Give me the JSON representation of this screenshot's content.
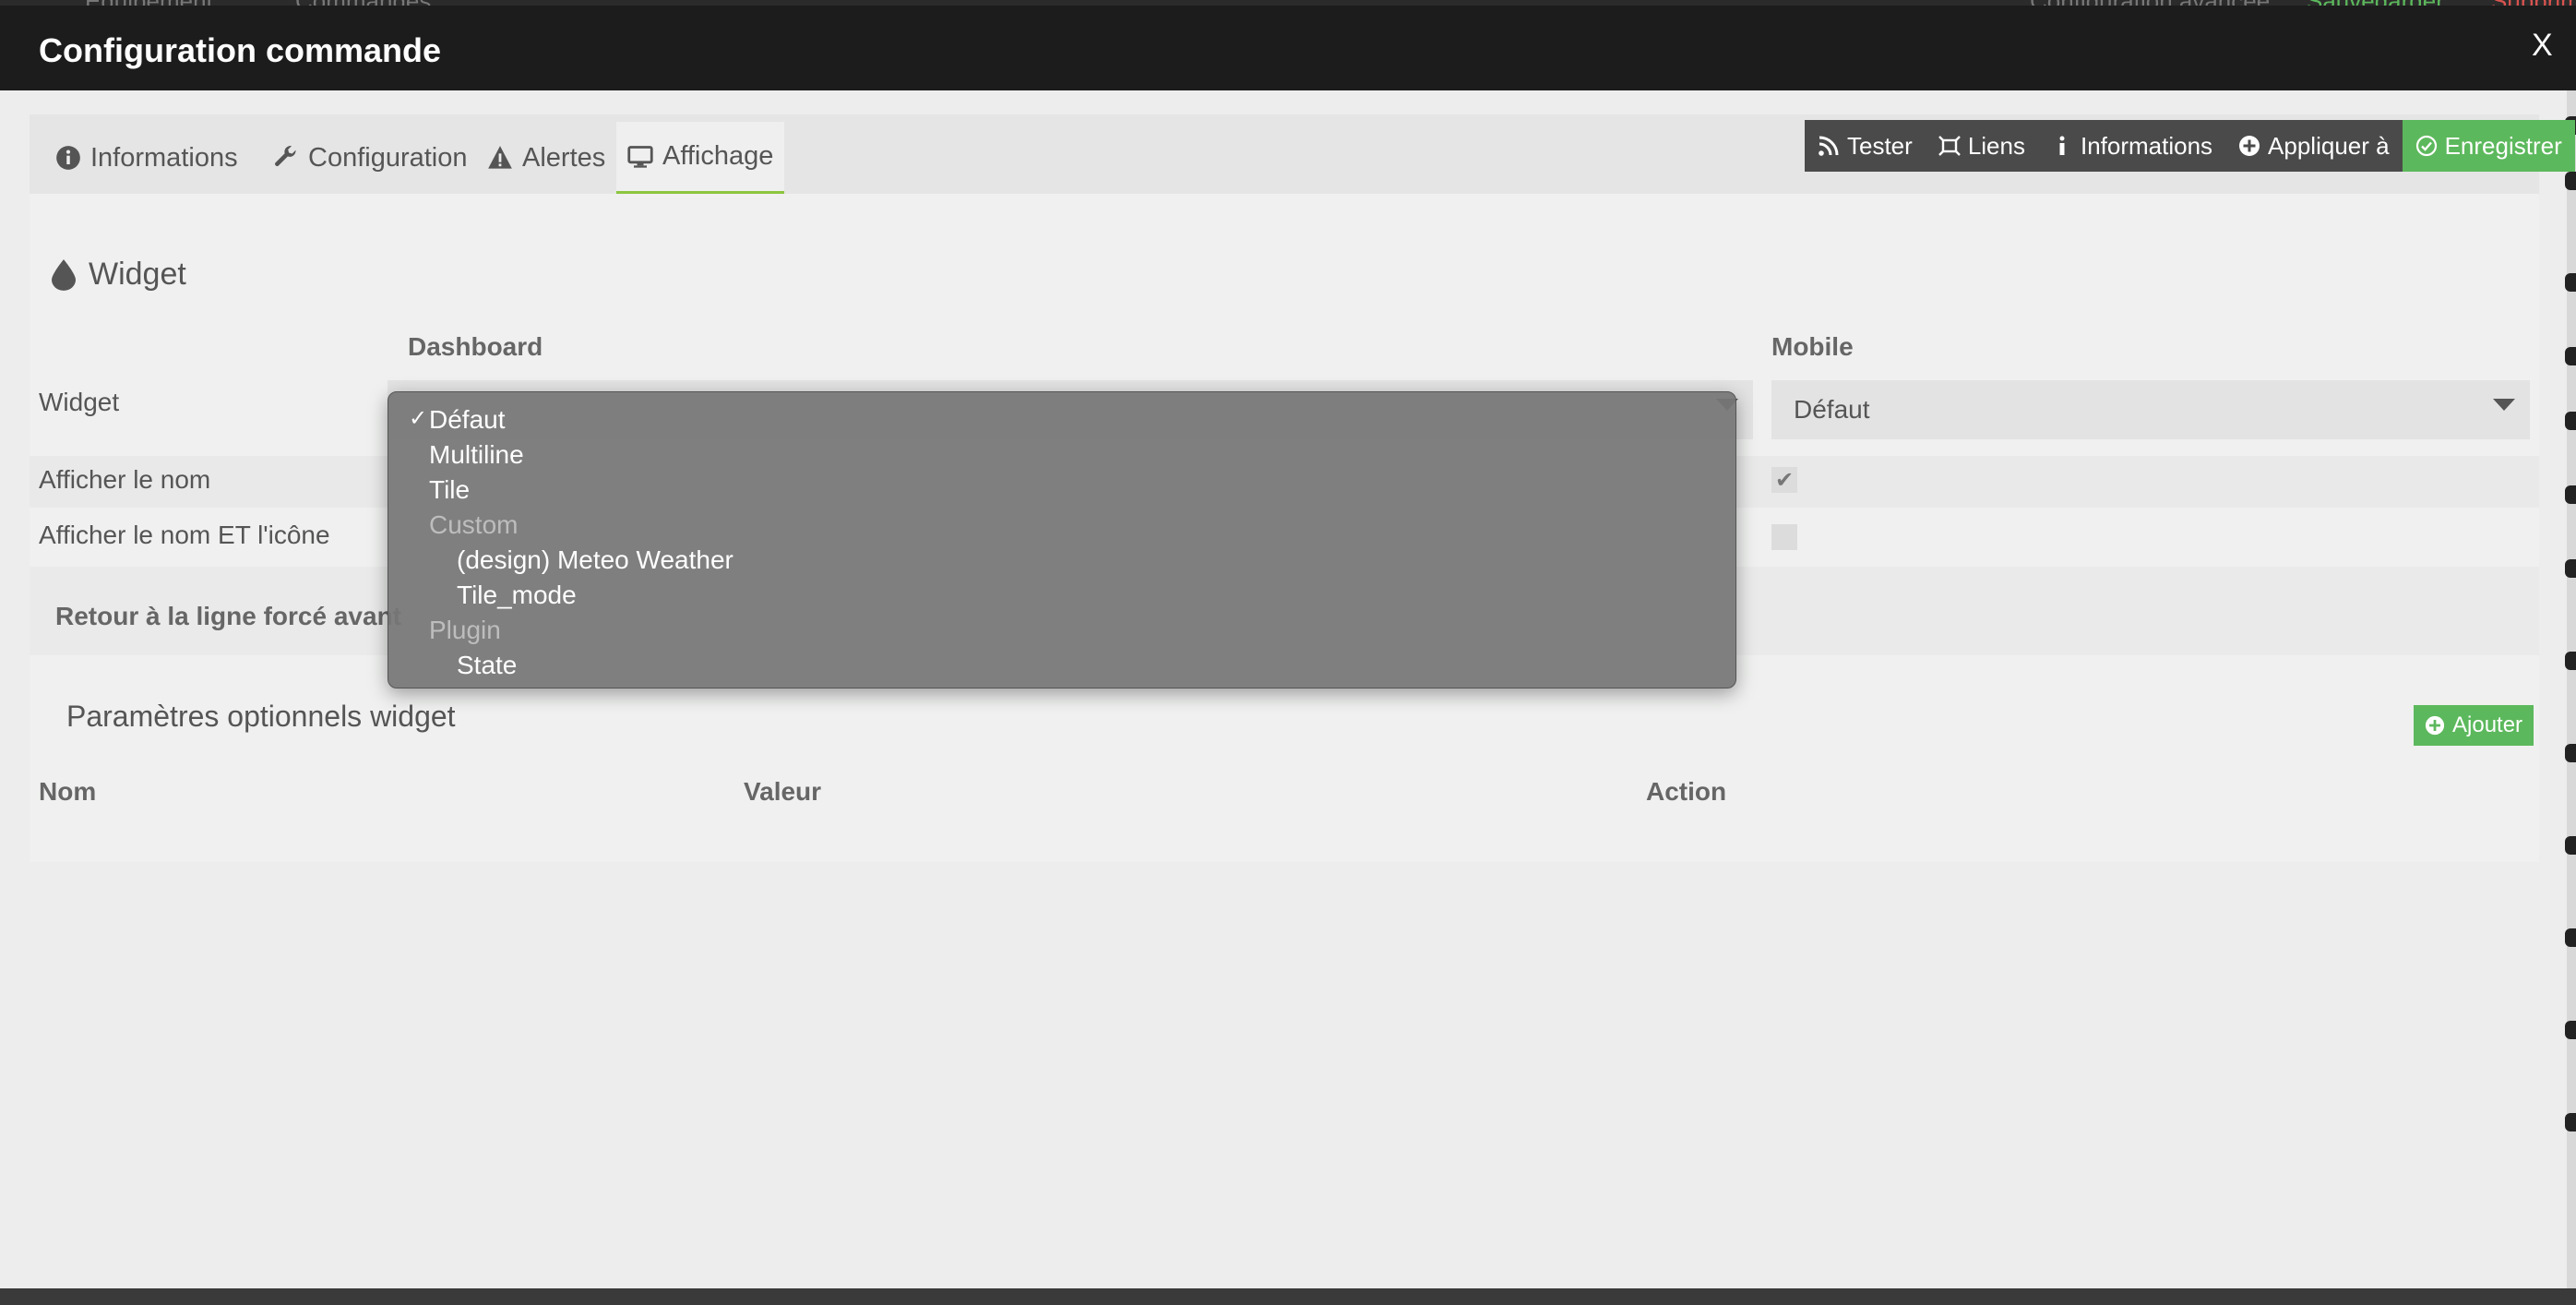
{
  "background": {
    "left_items": [
      "Équipement",
      "Commandes"
    ],
    "right_items": [
      "Configuration avancée",
      "Sauvegarder",
      "Supprimer"
    ]
  },
  "modal": {
    "title": "Configuration commande",
    "close_label": "X"
  },
  "tabs": [
    {
      "label": "Informations",
      "icon": "info-circle-icon"
    },
    {
      "label": "Configuration",
      "icon": "wrench-icon"
    },
    {
      "label": "Alertes",
      "icon": "warning-triangle-icon"
    },
    {
      "label": "Affichage",
      "icon": "monitor-icon"
    }
  ],
  "toolbar": [
    {
      "label": "Tester",
      "icon": "rss-icon"
    },
    {
      "label": "Liens",
      "icon": "link-icon"
    },
    {
      "label": "Informations",
      "icon": "info-icon"
    },
    {
      "label": "Appliquer à",
      "icon": "plus-circle-icon"
    },
    {
      "label": "Enregistrer",
      "icon": "check-circle-icon"
    }
  ],
  "widget_section": {
    "title": "Widget",
    "col_dashboard": "Dashboard",
    "col_mobile": "Mobile",
    "row_widget": "Widget",
    "row_show_name": "Afficher le nom",
    "row_show_name_icon": "Afficher le nom ET l'icône",
    "row_line_break": "Retour à la ligne forcé avant",
    "mobile_widget_value": "Défaut",
    "mobile_show_name_checked": "✔"
  },
  "dropdown": {
    "selected_mark": "✓",
    "options": [
      {
        "label": "Défaut",
        "selected": true
      },
      {
        "label": "Multiline"
      },
      {
        "label": "Tile"
      }
    ],
    "groups": [
      {
        "label": "Custom",
        "options": [
          "(design) Meteo Weather",
          "Tile_mode"
        ]
      },
      {
        "label": "Plugin",
        "options": [
          "State"
        ]
      }
    ]
  },
  "optional_params": {
    "title": "Paramètres optionnels widget",
    "add_label": "Ajouter",
    "col_name": "Nom",
    "col_value": "Valeur",
    "col_action": "Action"
  },
  "colors": {
    "header_bg": "#1c1c1c",
    "accent_green": "#5cb85c",
    "toolbar_dark": "#4a4a4a",
    "active_tab_underline": "#8cc63f"
  }
}
